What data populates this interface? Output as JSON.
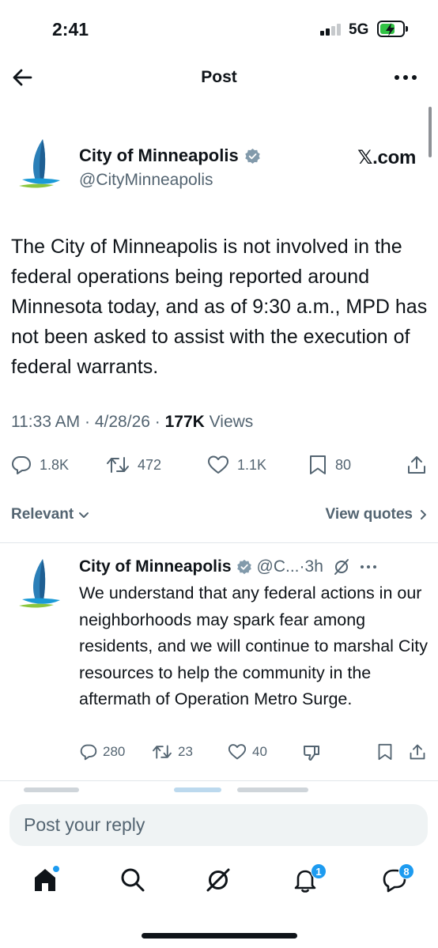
{
  "status_bar": {
    "time": "2:41",
    "network": "5G",
    "battery_charging": true
  },
  "header": {
    "title": "Post",
    "back_icon": "arrow-left-icon",
    "more_icon": "more-horizontal-icon"
  },
  "post": {
    "author_name": "City of Minneapolis",
    "handle": "@CityMinneapolis",
    "source_label": "𝕏.com",
    "text": "The City of Minneapolis is not involved in the federal operations being reported around Minnesota today, and as of 9:30 a.m., MPD has not been asked to assist with the execution of federal warrants.",
    "time": "11:33 AM",
    "date": "4/28/26",
    "views_count": "177K",
    "views_label": "Views",
    "separator": "·",
    "actions": {
      "replies": "1.8K",
      "reposts": "472",
      "likes": "1.1K",
      "bookmarks": "80"
    }
  },
  "filters": {
    "sort_label": "Relevant",
    "view_quotes_label": "View quotes"
  },
  "reply": {
    "author_name": "City of Minneapolis",
    "handle": "@C...",
    "dot": "·",
    "time": "3h",
    "text": "We understand that any federal actions in our neighborhoods may spark fear among residents, and we will continue to marshal City resources to help the community in the aftermath of Operation Metro Surge.",
    "actions": {
      "replies": "280",
      "reposts": "23",
      "likes": "40"
    }
  },
  "compose": {
    "placeholder": "Post your reply"
  },
  "bottom_nav": {
    "notifications_badge": "1",
    "messages_badge": "8"
  },
  "colors": {
    "text": "#0f1419",
    "secondary": "#536471",
    "accent": "#1d9bf0",
    "divider": "#e1e6ea",
    "input_bg": "#eff3f4"
  }
}
